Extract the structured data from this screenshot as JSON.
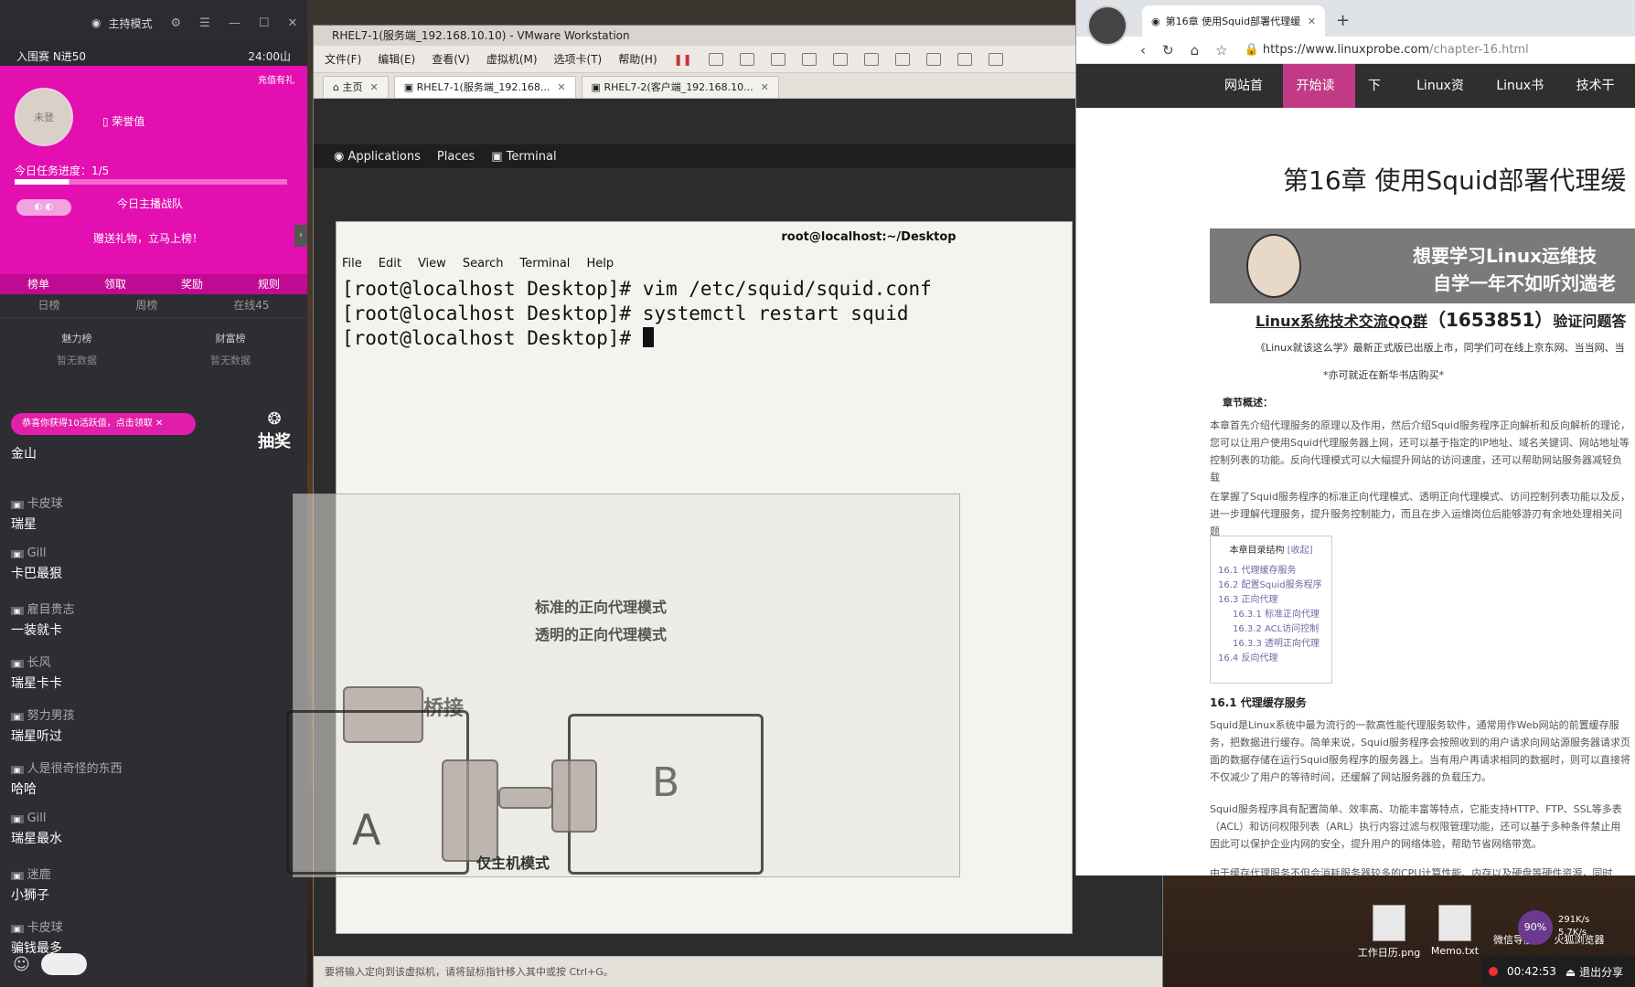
{
  "stream": {
    "mode_title": "主持模式",
    "rank": "入围赛 N进50",
    "rank_points": "24:00山",
    "avatar_placeholder": "未登",
    "honor_label": "荣誉值",
    "gift_badge": "充值有礼",
    "task_progress": "今日任务进度：1/5",
    "task_fraction": 0.2,
    "team_label": "今日主播战队",
    "send_gift": "赠送礼物，立马上榜！",
    "tabs": [
      "榜单",
      "领取",
      "奖励",
      "规则"
    ],
    "periods": [
      "日榜",
      "周榜",
      "在线45"
    ],
    "boards": [
      {
        "label": "魅力榜",
        "sub": "暂无数据"
      },
      {
        "label": "财富榜",
        "sub": "暂无数据"
      }
    ],
    "notice": "恭喜你获得10活跃值，点击领取",
    "lottery": "抽奖",
    "chat": [
      {
        "name": "",
        "text": "金山"
      },
      {
        "name": "卡皮球",
        "text": "瑞星"
      },
      {
        "name": "Gill",
        "text": "卡巴最狠"
      },
      {
        "name": "雇目贵志",
        "text": "一装就卡"
      },
      {
        "name": "长风",
        "text": "瑞星卡卡"
      },
      {
        "name": "努力男孩",
        "text": "瑞星听过"
      },
      {
        "name": "人是很奇怪的东西",
        "text": "哈哈"
      },
      {
        "name": "Gill",
        "text": "瑞星最水"
      },
      {
        "name": "迷鹿",
        "text": "小狮子"
      },
      {
        "name": "卡皮球",
        "text": "骗钱最多"
      }
    ]
  },
  "vmware": {
    "title": "RHEL7-1(服务端_192.168.10.10) - VMware Workstation",
    "menu": [
      "文件(F)",
      "编辑(E)",
      "查看(V)",
      "虚拟机(M)",
      "选项卡(T)",
      "帮助(H)"
    ],
    "tabs": [
      {
        "label": "主页"
      },
      {
        "label": "RHEL7-1(服务端_192.168..."
      },
      {
        "label": "RHEL7-2(客户端_192.168.10..."
      }
    ],
    "gnome": {
      "applications": "Applications",
      "places": "Places",
      "terminal": "Terminal"
    },
    "status": "要将输入定向到该虚拟机，请将鼠标指针移入其中或按 Ctrl+G。"
  },
  "terminal": {
    "title": "root@localhost:~/Desktop",
    "menu": [
      "File",
      "Edit",
      "View",
      "Search",
      "Terminal",
      "Help"
    ],
    "lines": [
      "[root@localhost Desktop]# vim /etc/squid/squid.conf",
      "[root@localhost Desktop]# systemctl restart squid",
      "[root@localhost Desktop]# "
    ]
  },
  "overlay": {
    "mode1": "标准的正向代理模式",
    "mode2": "透明的正向代理模式",
    "bridge": "桥接",
    "host_only": "仅主机模式",
    "label_a": "A",
    "label_b": "B"
  },
  "browser": {
    "tab_title": "第16章 使用Squid部署代理缓",
    "url_prefix": "https://www.",
    "url_host": "linuxprobe.com",
    "url_path": "/chapter-16.html",
    "nav": [
      "网站首页",
      "开始读书",
      "下载",
      "Linux资讯",
      "Linux书籍",
      "技术干货"
    ],
    "heading": "第16章 使用Squid部署代理缓",
    "banner_l1": "想要学习Linux运维技",
    "banner_l2": "自学一年不如听刘遄老",
    "qq_text": "Linux系统技术交流QQ群",
    "qq_number": "（1653851）",
    "qq_suffix": "验证问题答",
    "book_line": "《Linux就该这么学》最新正式版已出版上市，同学们可在线上京东网、当当网、当",
    "book_line2": "*亦可就近在新华书店购买*",
    "overview": "章节概述：",
    "para1": "本章首先介绍代理服务的原理以及作用，然后介绍Squid服务程序正向解析和反向解析的理论，您可以让用户使用Squid代理服务器上网，还可以基于指定的IP地址、域名关键词、网站地址等控制列表的功能。反向代理模式可以大幅提升网站的访问速度，还可以帮助网站服务器减轻负载",
    "para2": "在掌握了Squid服务程序的标准正向代理模式、透明正向代理模式、访问控制列表功能以及反，进一步理解代理服务，提升服务控制能力，而且在步入运维岗位后能够游刃有余地处理相关问题",
    "toc_title": "本章目录结构",
    "toc_fold": "[收起]",
    "toc": [
      {
        "text": "16.1 代理缓存服务",
        "sub": false
      },
      {
        "text": "16.2 配置Squid服务程序",
        "sub": false
      },
      {
        "text": "16.3 正向代理",
        "sub": false
      },
      {
        "text": "16.3.1 标准正向代理",
        "sub": true
      },
      {
        "text": "16.3.2 ACL访问控制",
        "sub": true
      },
      {
        "text": "16.3.3 透明正向代理",
        "sub": true
      },
      {
        "text": "16.4 反向代理",
        "sub": false
      }
    ],
    "section": "16.1 代理缓存服务",
    "para3": "Squid是Linux系统中最为流行的一款高性能代理服务软件，通常用作Web网站的前置缓存服务，把数据进行缓存。简单来说，Squid服务程序会按照收到的用户请求向网站源服务器请求页面的数据存储在运行Squid服务程序的服务器上。当有用户再请求相同的数据时，则可以直接将不仅减少了用户的等待时间，还缓解了网站服务器的负载压力。",
    "para4": "Squid服务程序具有配置简单、效率高、功能丰富等特点，它能支持HTTP、FTP、SSL等多表（ACL）和访问权限列表（ARL）执行内容过滤与权限管理功能，还可以基于多种条件禁止用因此可以保护企业内网的安全，提升用户的网络体验，帮助节省网络带宽。",
    "para5": "由于缓存代理服务不但会消耗服务器较多的CPU计算性能、内存以及硬盘等硬件资源，同时"
  },
  "desktop": {
    "icons": [
      {
        "label": "工作日历.png"
      },
      {
        "label": "Memo.txt"
      },
      {
        "label": "微信导航"
      },
      {
        "label": "火狐浏览器"
      }
    ],
    "net_percent": "90%",
    "up_rate": "291K/s",
    "down_rate": "5.7K/s",
    "timer": "00:42:53",
    "share_label": "退出分享"
  }
}
